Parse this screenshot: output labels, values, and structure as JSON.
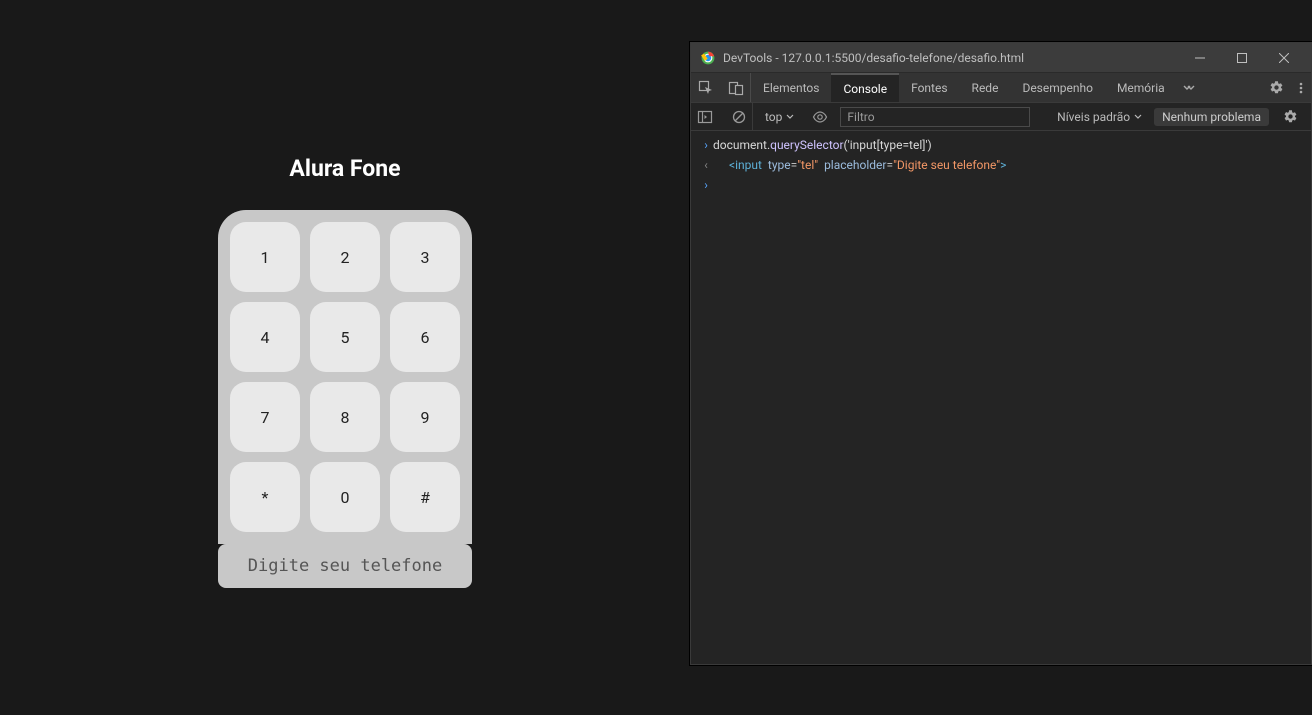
{
  "app": {
    "title": "Alura Fone",
    "keys": [
      "1",
      "2",
      "3",
      "4",
      "5",
      "6",
      "7",
      "8",
      "9",
      "*",
      "0",
      "#"
    ],
    "input_placeholder": "Digite seu telefone"
  },
  "devtools": {
    "window_title": "DevTools - 127.0.0.1:5500/desafio-telefone/desafio.html",
    "tabs": [
      "Elementos",
      "Console",
      "Fontes",
      "Rede",
      "Desempenho",
      "Memória"
    ],
    "active_tab": "Console",
    "toolbar": {
      "context": "top",
      "filter_placeholder": "Filtro",
      "levels_label": "Níveis padrão",
      "issues_label": "Nenhum problema"
    },
    "console": {
      "input_prefix": "document.",
      "input_method": "querySelector",
      "input_args": "('input[type=tel]')",
      "output_tag_open": "<input",
      "output_attr1_name": "type",
      "output_attr1_eq": "=",
      "output_attr1_val": "\"tel\"",
      "output_attr2_name": "placeholder",
      "output_attr2_eq": "=",
      "output_attr2_val": "\"Digite seu telefone\"",
      "output_tag_close": ">"
    }
  }
}
